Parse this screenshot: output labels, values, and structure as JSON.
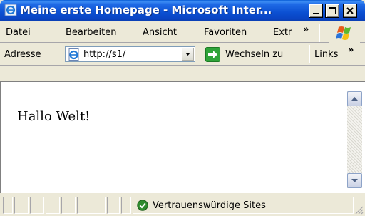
{
  "window": {
    "title": "Meine erste Homepage - Microsoft Inter...",
    "icons": {
      "app": "ie-page-icon",
      "minimize": "minimize-icon",
      "maximize": "maximize-icon",
      "close": "close-icon"
    }
  },
  "menu": {
    "items": [
      {
        "pre": "",
        "key": "D",
        "post": "atei"
      },
      {
        "pre": "",
        "key": "B",
        "post": "earbeiten"
      },
      {
        "pre": "",
        "key": "A",
        "post": "nsicht"
      },
      {
        "pre": "",
        "key": "F",
        "post": "avoriten"
      },
      {
        "pre": "E",
        "key": "x",
        "post": "tr"
      }
    ],
    "overflow": "»"
  },
  "address": {
    "label_pre": "Adre",
    "label_key": "s",
    "label_post": "se",
    "value": "http://s1/",
    "go_label": "Wechseln zu",
    "links_label": "Links",
    "links_overflow": "»"
  },
  "page": {
    "text": "Hallo Welt!"
  },
  "status": {
    "zone": "Vertrauenswürdige Sites",
    "zone_icon": "check-shield-icon"
  },
  "colors": {
    "titlebar": "#0b4fd1",
    "chrome": "#ece9d8",
    "go_green": "#2fa339"
  }
}
